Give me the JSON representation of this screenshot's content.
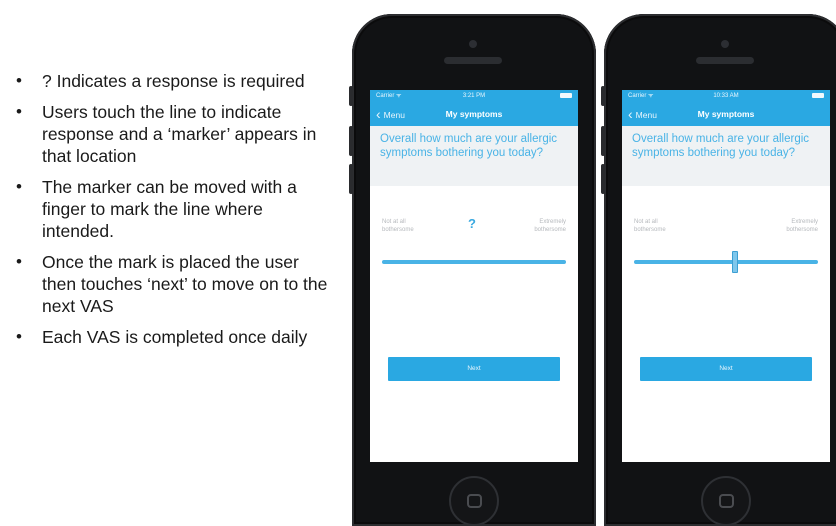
{
  "bullets": [
    "? Indicates a response is required",
    "Users touch the line to indicate response and a ‘marker’ appears in that location",
    "The marker can be moved with a finger to mark the line where intended.",
    "Once the mark is placed the user then touches ‘next’ to move on to the next VAS",
    "Each VAS is completed once daily"
  ],
  "bullet_symbol": "•",
  "phones": [
    {
      "status": {
        "carrier": "Carrier ᯤ",
        "time": "3:21 PM"
      },
      "nav": {
        "back_label": "Menu",
        "title": "My symptoms"
      },
      "question": "Overall how much are your allergic symptoms bothering you today?",
      "anchor_low": "Not at all bothersome",
      "anchor_high": "Extremely bothersome",
      "required_mark": "?",
      "marker_position": null,
      "next_label": "Next"
    },
    {
      "status": {
        "carrier": "Carrier ᯤ",
        "time": "10:33 AM"
      },
      "nav": {
        "back_label": "Menu",
        "title": "My symptoms"
      },
      "question": "Overall how much are your allergic symptoms bothering you today?",
      "anchor_low": "Not at all bothersome",
      "anchor_high": "Extremely bothersome",
      "required_mark": "",
      "marker_position": 0.55,
      "next_label": "Next"
    }
  ],
  "icons": {
    "back": "chevron-left-icon",
    "battery": "battery-icon",
    "home": "home-button-icon"
  },
  "colors": {
    "accent": "#2aa8e2",
    "question_text": "#49b3e6",
    "question_bg": "#eff2f4",
    "phone_body": "#111214"
  }
}
